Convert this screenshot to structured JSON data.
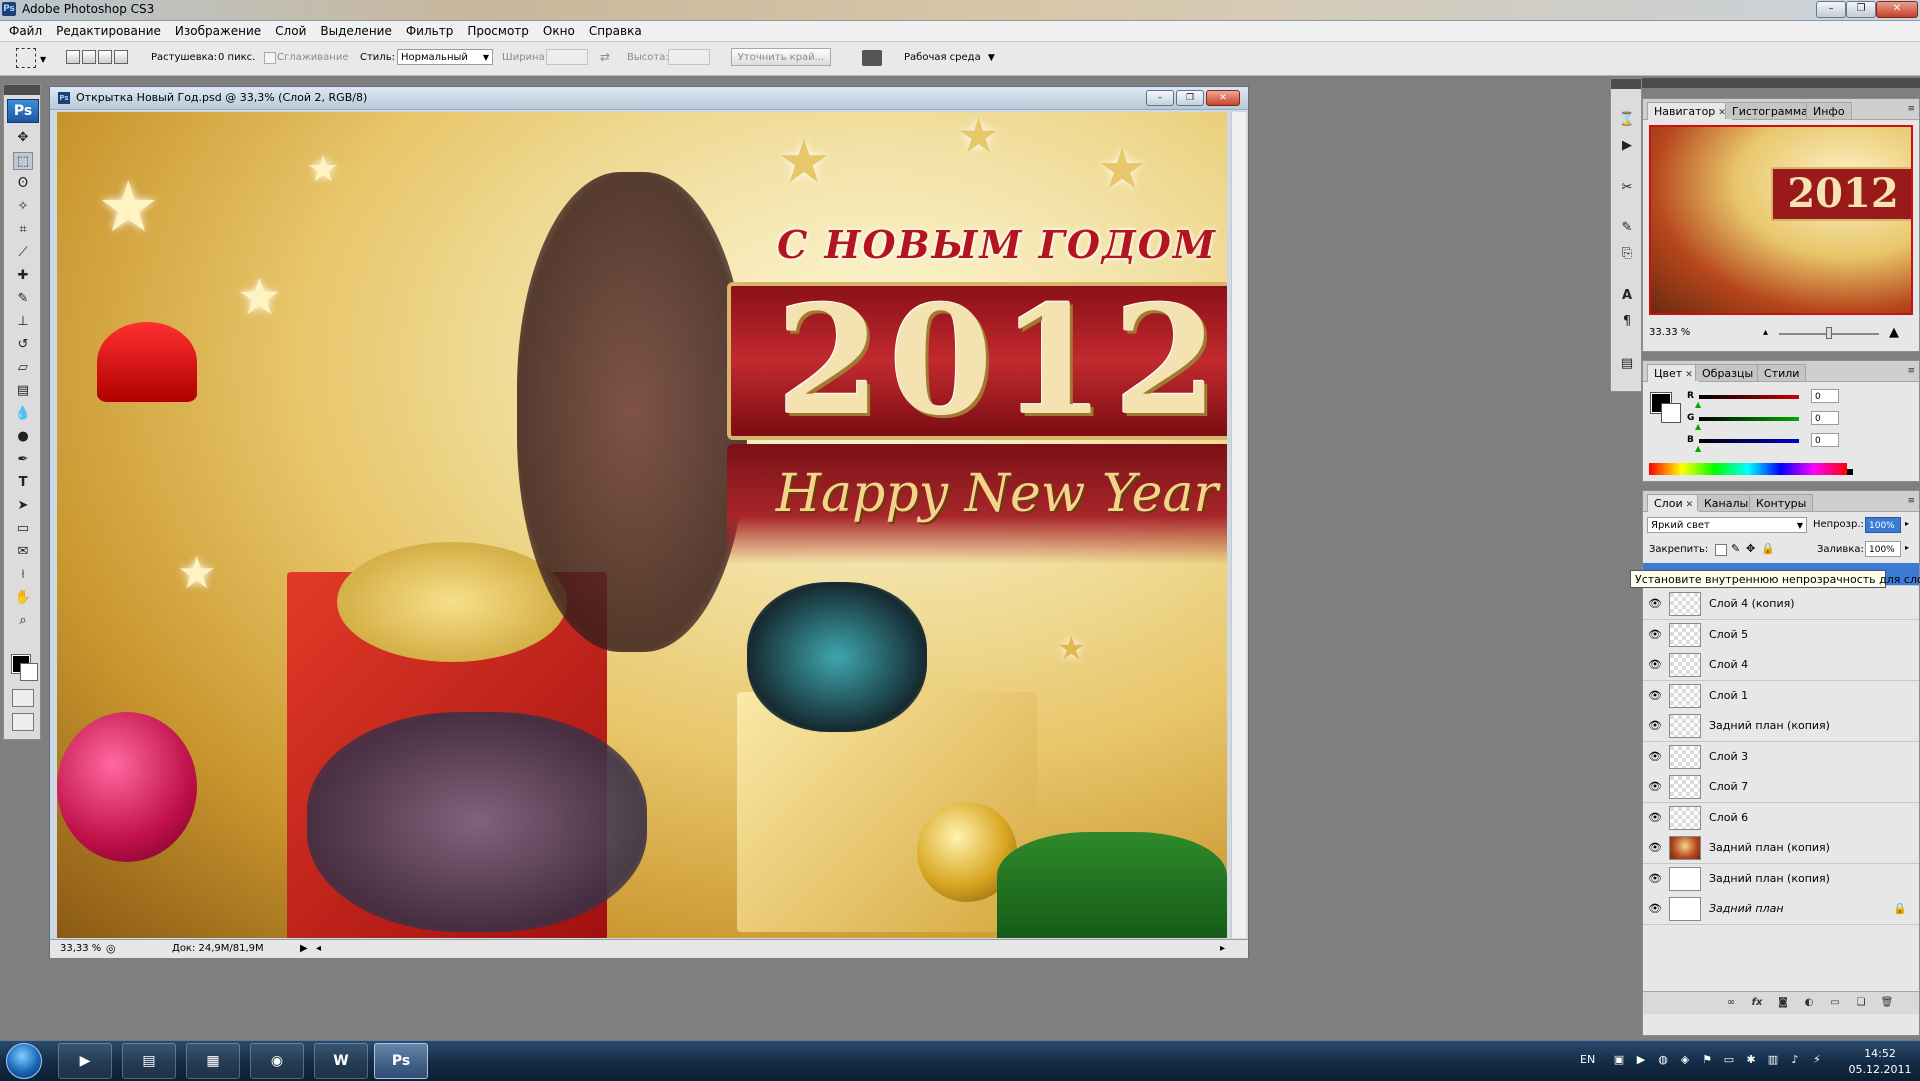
{
  "app": {
    "title": "Adobe Photoshop CS3",
    "icon_label": "Ps"
  },
  "window_controls": {
    "minimize": "–",
    "restore": "❐",
    "close": "✕"
  },
  "menu": {
    "items": [
      "Файл",
      "Редактирование",
      "Изображение",
      "Слой",
      "Выделение",
      "Фильтр",
      "Просмотр",
      "Окно",
      "Справка"
    ]
  },
  "options": {
    "feather_label": "Растушевка:",
    "feather_value": "0 пикс.",
    "antialias_label": "Сглаживание",
    "style_label": "Стиль:",
    "style_value": "Нормальный",
    "width_label": "Ширина:",
    "height_label": "Высота:",
    "refine_edge": "Уточнить край...",
    "workspace": "Рабочая среда"
  },
  "toolbox": {
    "logo": "Ps",
    "tools": [
      "move-tool",
      "marquee-tool",
      "lasso-tool",
      "magic-wand-tool",
      "crop-tool",
      "slice-tool",
      "healing-tool",
      "brush-tool",
      "stamp-tool",
      "history-brush-tool",
      "eraser-tool",
      "gradient-tool",
      "blur-tool",
      "dodge-tool",
      "pen-tool",
      "type-tool",
      "path-select-tool",
      "shape-tool",
      "notes-tool",
      "eyedropper-tool",
      "hand-tool",
      "zoom-tool"
    ]
  },
  "document": {
    "title": "Открытка Новый Год.psd @ 33,3% (Слой 2, RGB/8)",
    "zoom": "33,33 %",
    "doc_size": "Док: 24,9M/81,9M",
    "art": {
      "greeting_ru": "С НОВЫМ ГОДОМ",
      "year": "2012",
      "greeting_en": "Happy New Year"
    }
  },
  "navigator": {
    "tabs": [
      "Навигатор",
      "Гистограмма",
      "Инфо"
    ],
    "zoom": "33.33 %",
    "zoom_fraction": 0.5,
    "thumb_year": "2012"
  },
  "color": {
    "tabs": [
      "Цвет",
      "Образцы",
      "Стили"
    ],
    "channels": [
      {
        "label": "R",
        "value": "0",
        "color": "#cc0000"
      },
      {
        "label": "G",
        "value": "0",
        "color": "#00aa00"
      },
      {
        "label": "B",
        "value": "0",
        "color": "#0000cc"
      }
    ],
    "foreground": "#000000",
    "background": "#ffffff"
  },
  "layers": {
    "tabs": [
      "Слои",
      "Каналы",
      "Контуры"
    ],
    "blend_mode": "Яркий свет",
    "opacity_label": "Непрозр.:",
    "opacity_value": "100%",
    "lock_label": "Закрепить:",
    "fill_label": "Заливка:",
    "fill_value": "100%",
    "tooltip": "Установите внутреннюю непрозрачность для слоя",
    "rows": [
      {
        "name": "Слой 4 (копия)",
        "thumb": "transparent"
      },
      {
        "name": "Слой 5",
        "thumb": "transparent"
      },
      {
        "name": "Слой 4",
        "thumb": "transparent"
      },
      {
        "name": "Слой 1",
        "thumb": "transparent"
      },
      {
        "name": "Задний план (копия)",
        "thumb": "transparent"
      },
      {
        "name": "Слой 3",
        "thumb": "transparent"
      },
      {
        "name": "Слой 7",
        "thumb": "transparent"
      },
      {
        "name": "Слой 6",
        "thumb": "transparent"
      },
      {
        "name": "Задний план (копия)",
        "thumb": "image"
      },
      {
        "name": "Задний план (копия)",
        "thumb": "white"
      },
      {
        "name": "Задний план",
        "thumb": "white",
        "locked": true
      }
    ]
  },
  "taskbar": {
    "apps": [
      "media-player",
      "file-explorer",
      "system-monitor",
      "chrome",
      "word",
      "photoshop"
    ],
    "photoshop_label": "Ps",
    "word_label": "W",
    "lang": "EN",
    "time": "14:52",
    "date": "05.12.2011"
  }
}
